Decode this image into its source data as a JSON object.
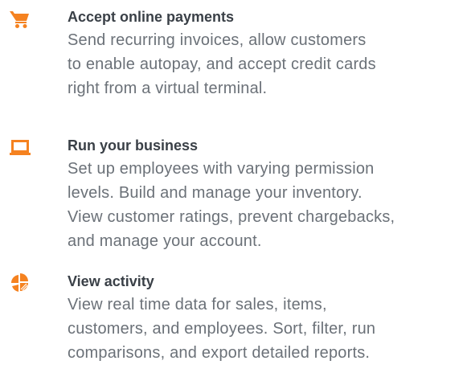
{
  "colors": {
    "accent": "#f58220",
    "title": "#3a4047",
    "body": "#6b7178"
  },
  "features": [
    {
      "icon": "shopping-cart-icon",
      "title": "Accept online payments",
      "lines": [
        "Send recurring invoices, allow customers",
        "to enable autopay, and accept credit cards",
        "right from a virtual terminal."
      ]
    },
    {
      "icon": "laptop-icon",
      "title": "Run your business",
      "lines": [
        "Set up employees with varying permission",
        "levels. Build and manage your inventory.",
        "View customer ratings, prevent chargebacks,",
        "and manage your account."
      ]
    },
    {
      "icon": "pie-chart-icon",
      "title": "View activity",
      "lines": [
        "View real time data for sales, items,",
        "customers, and employees. Sort, filter, run",
        "comparisons, and export detailed reports."
      ]
    }
  ]
}
